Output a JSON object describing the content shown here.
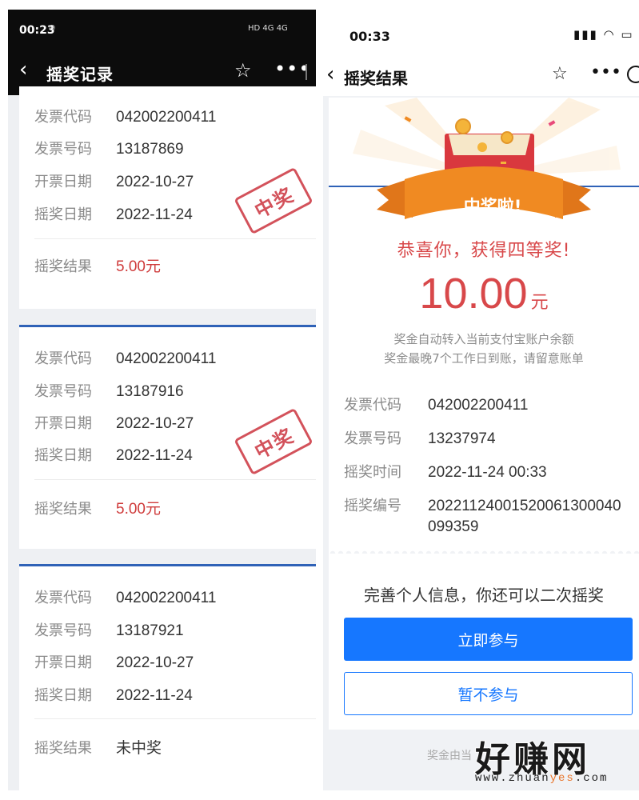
{
  "left": {
    "status": {
      "time": "00:23",
      "icons": "HD 4G 4G"
    },
    "nav": {
      "back": "‹",
      "title": "摇奖记录",
      "star": "☆",
      "more": "•••"
    },
    "records": [
      {
        "rows": [
          {
            "label": "发票代码",
            "value": "042002200411"
          },
          {
            "label": "发票号码",
            "value": "13187869"
          },
          {
            "label": "开票日期",
            "value": "2022-10-27"
          },
          {
            "label": "摇奖日期",
            "value": "2022-11-24"
          }
        ],
        "result_label": "摇奖结果",
        "result_value": "5.00元",
        "won": true,
        "stamp": "中奖"
      },
      {
        "rows": [
          {
            "label": "发票代码",
            "value": "042002200411"
          },
          {
            "label": "发票号码",
            "value": "13187916"
          },
          {
            "label": "开票日期",
            "value": "2022-10-27"
          },
          {
            "label": "摇奖日期",
            "value": "2022-11-24"
          }
        ],
        "result_label": "摇奖结果",
        "result_value": "5.00元",
        "won": true,
        "stamp": "中奖"
      },
      {
        "rows": [
          {
            "label": "发票代码",
            "value": "042002200411"
          },
          {
            "label": "发票号码",
            "value": "13187921"
          },
          {
            "label": "开票日期",
            "value": "2022-10-27"
          },
          {
            "label": "摇奖日期",
            "value": "2022-11-24"
          }
        ],
        "result_label": "摇奖结果",
        "result_value": "未中奖",
        "won": false
      }
    ]
  },
  "right": {
    "status": {
      "time": "00:33",
      "icons": "▮▮▮ ◠ ▭"
    },
    "nav": {
      "back": "‹",
      "title": "摇奖结果",
      "star": "☆",
      "more": "•••"
    },
    "ribbon": "中奖啦!",
    "congrats": "恭喜你，获得四等奖!",
    "amount": "10.00",
    "unit": "元",
    "note1": "奖金自动转入当前支付宝账户余额",
    "note2": "奖金最晚7个工作日到账，请留意账单",
    "details": [
      {
        "label": "发票代码",
        "value": "042002200411"
      },
      {
        "label": "发票号码",
        "value": "13237974"
      },
      {
        "label": "摇奖时间",
        "value": "2022-11-24 00:33"
      },
      {
        "label": "摇奖编号",
        "value": "20221124001520061300040",
        "value2": "099359"
      }
    ],
    "second_chance": "完善个人信息，你还可以二次摇奖",
    "btn_join": "立即参与",
    "btn_skip": "暂不参与",
    "footer": "奖金由当"
  },
  "watermark": {
    "big": "好赚网",
    "small_a": "www.zhuan",
    "small_b": "yes",
    "small_c": ".com"
  },
  "colors": {
    "accent_blue": "#1677ff",
    "prize_red": "#d8484a",
    "stamp_red": "#d3525b",
    "ribbon_orange": "#f08a22"
  }
}
